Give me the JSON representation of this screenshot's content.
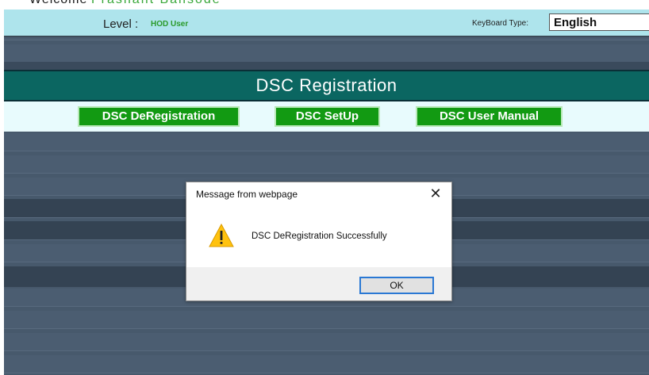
{
  "header": {
    "welcome": "Welcome",
    "welcome_name": "Prashant Bansode",
    "level_label": "Level :",
    "level_value": "HOD User",
    "keyboard_label": "KeyBoard Type:",
    "keyboard_value": "English"
  },
  "page_title": "DSC Registration",
  "menu": [
    {
      "label": "DSC DeRegistration"
    },
    {
      "label": "DSC SetUp"
    },
    {
      "label": "DSC User Manual"
    }
  ],
  "dialog": {
    "title": "Message from webpage",
    "message": "DSC DeRegistration Successfully",
    "ok_label": "OK",
    "close_glyph": "✕",
    "icon": "warning-icon"
  },
  "colors": {
    "title_bar": "#0b6661",
    "menu_button": "#129a12",
    "top_bar": "#aee4ec",
    "level_value": "#2a9a2a",
    "warning_icon": "#ffc20e"
  }
}
